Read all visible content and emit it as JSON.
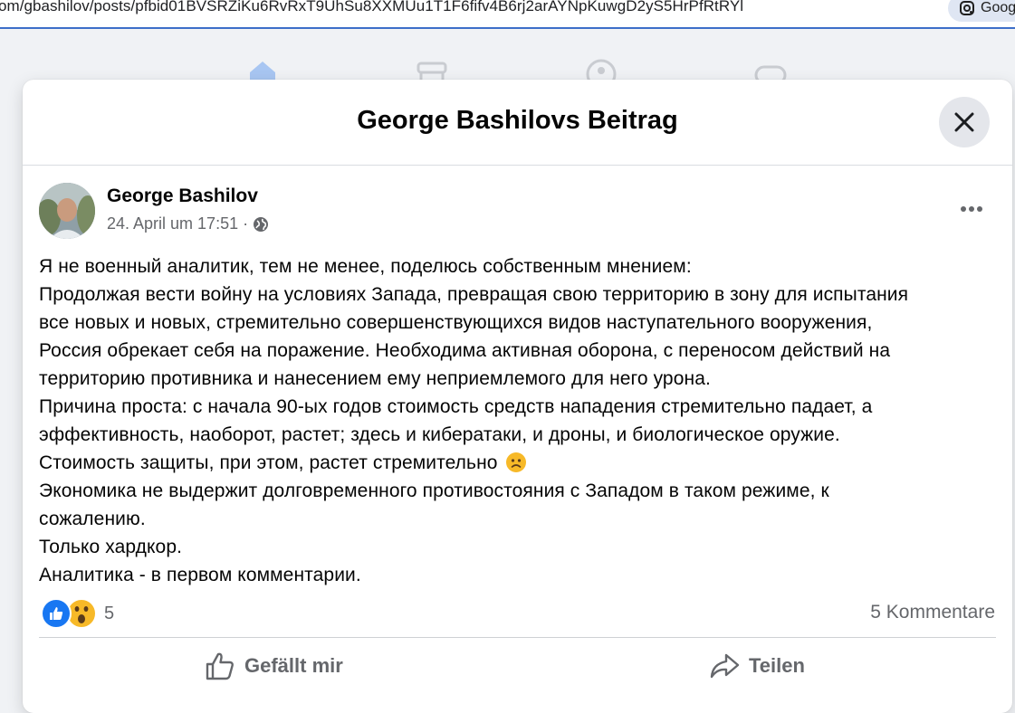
{
  "browser": {
    "url": "om/gbashilov/posts/pfbid01BVSRZiKu6RvRxT9UhSu8XXMUu1T1F6fifv4B6rj2arAYNpKuwgD2yS5HrPfRtRYl",
    "chip_label": "Goog"
  },
  "modal": {
    "title": "George Bashilovs Beitrag"
  },
  "post": {
    "author": "George Bashilov",
    "timestamp": "24. April um 17:51",
    "separator": "·",
    "privacy_icon": "globe-icon",
    "lines": [
      "Я не военный аналитик, тем не менее,  поделюсь собственным мнением:",
      "Продолжая вести войну на условиях Запада, превращая свою территорию в зону для испытания",
      "все новых и новых, стремительно совершенствующихся видов наступательного вооружения,",
      "Россия обрекает себя на поражение. Необходима активная оборона, с переносом действий на",
      "территорию противника и нанесением ему неприемлемого  для него урона.",
      "Причина проста: с начала 90-ых годов стоимость средств нападения стремительно падает, а",
      "эффективность, наоборот, растет; здесь и кибератаки, и дроны, и биологическое оружие.",
      "Стоимость защиты, при этом,  растет стремительно",
      "Экономика не выдержит долговременного противостояния с Западом в таком режиме, к",
      "сожалению.",
      "Только хардкор.",
      "Аналитика - в первом комментарии."
    ],
    "reaction_count": "5",
    "comment_count": "5 Kommentare"
  },
  "actions": {
    "like_label": "Gefällt mir",
    "share_label": "Teilen"
  },
  "colors": {
    "fb_blue": "#1877f2",
    "secondary_text": "#65676b",
    "close_bg": "#e4e6eb",
    "page_bg": "#f0f2f5"
  }
}
